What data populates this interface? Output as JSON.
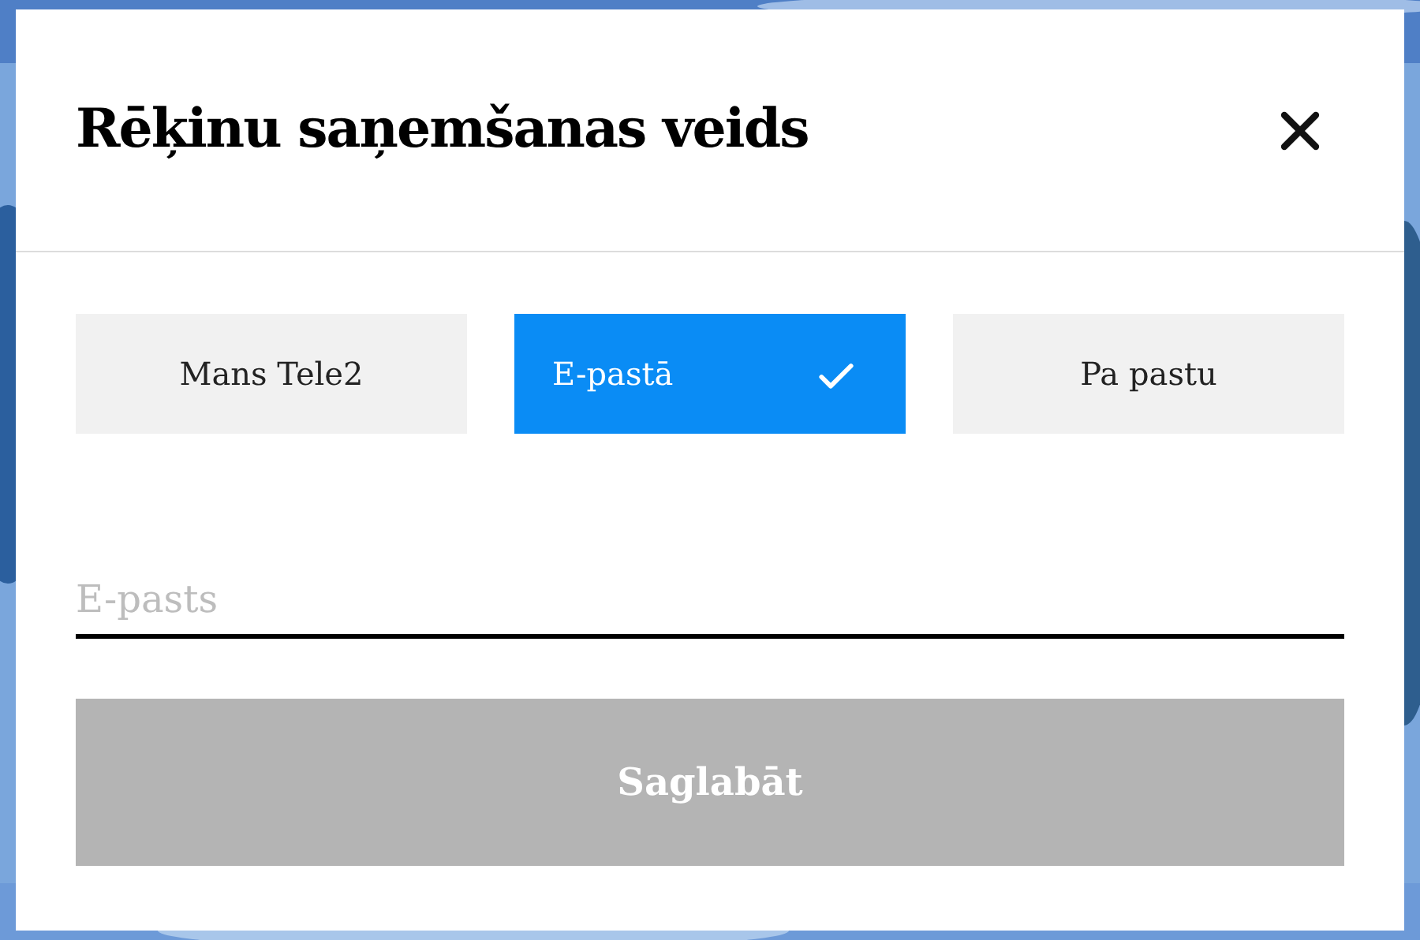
{
  "dialog": {
    "title": "Rēķinu saņemšanas veids",
    "options": [
      {
        "label": "Mans Tele2",
        "selected": false
      },
      {
        "label": "E-pastā",
        "selected": true
      },
      {
        "label": "Pa pastu",
        "selected": false
      }
    ],
    "email_field": {
      "placeholder": "E-pasts"
    },
    "save_button": {
      "label": "Saglabāt",
      "disabled": true
    }
  }
}
